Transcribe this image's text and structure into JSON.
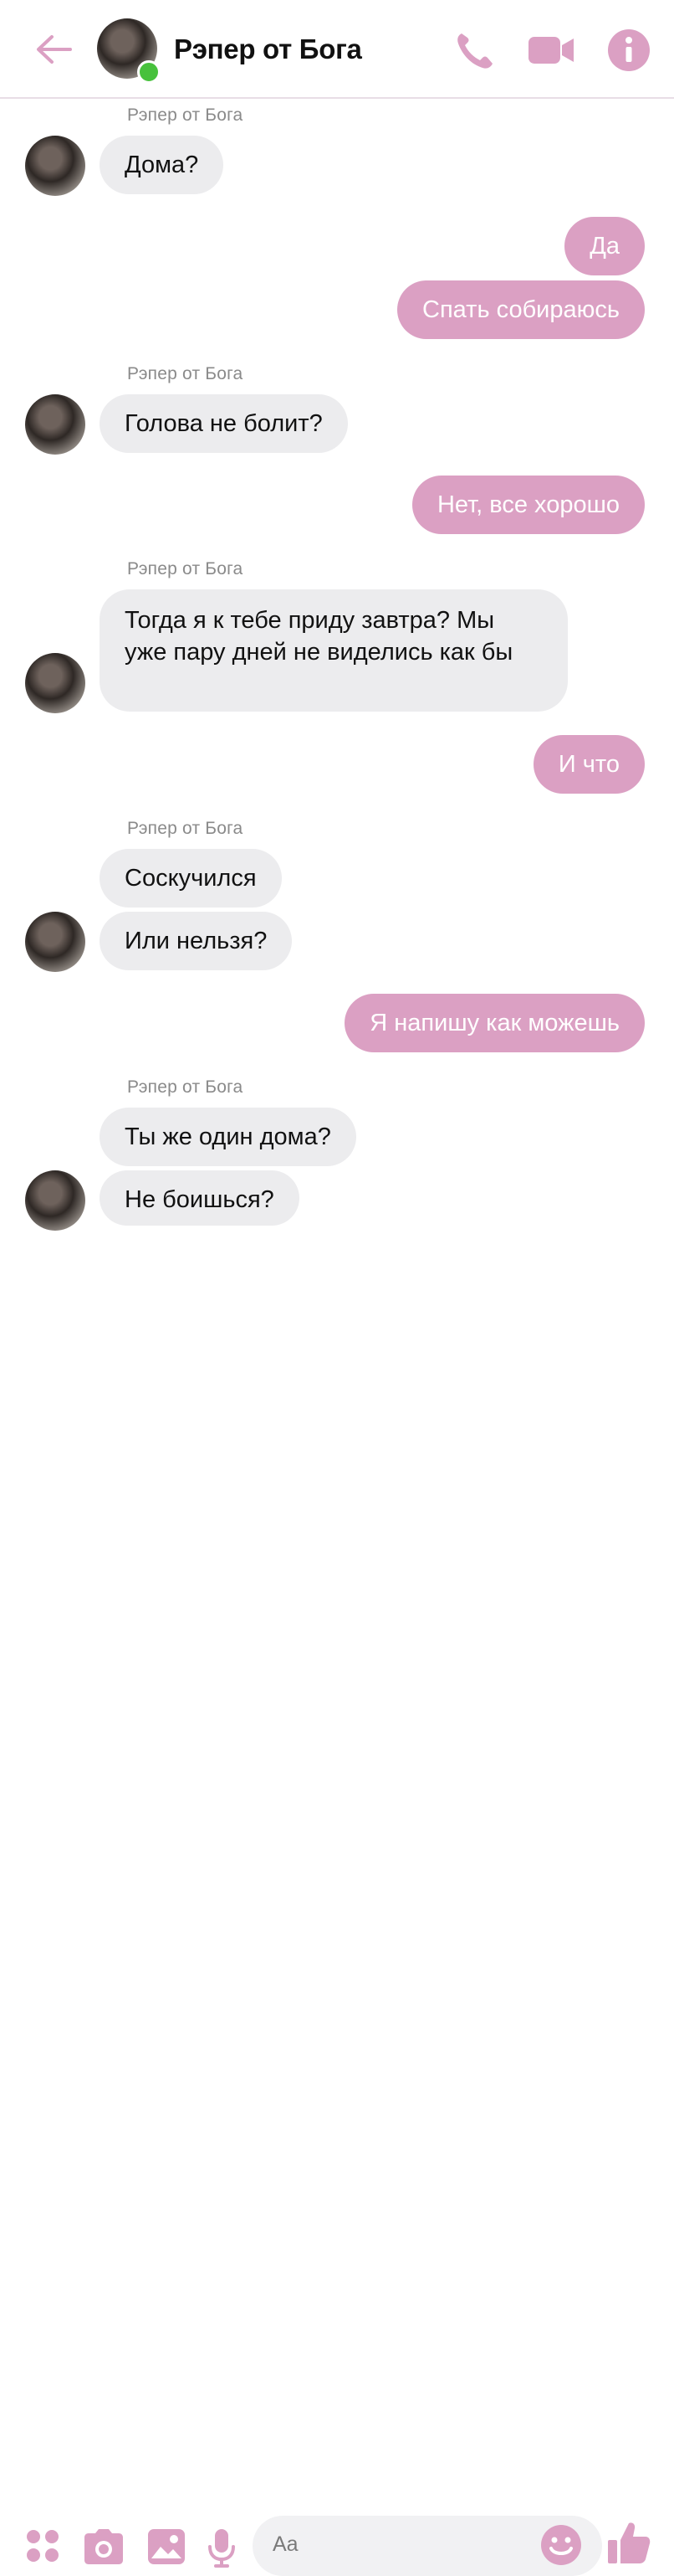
{
  "header": {
    "title": "Рэпер от Бога"
  },
  "accent_color": "#dba0c3",
  "incoming_bubble_color": "#ececee",
  "icons": {
    "back": "arrow-left-icon",
    "call": "phone-icon",
    "video": "video-camera-icon",
    "info": "info-icon",
    "apps": "four-dots-icon",
    "camera": "camera-icon",
    "gallery": "image-icon",
    "mic": "microphone-icon",
    "emoji": "smiley-icon",
    "like": "thumbs-up-icon"
  },
  "messages": [
    {
      "sender": "Рэпер от Бога",
      "text": "Дома?"
    },
    {
      "text": "Да"
    },
    {
      "text": "Спать собираюсь"
    },
    {
      "sender": "Рэпер от Бога",
      "text": "Голова не болит?"
    },
    {
      "text": "Нет, все хорошо"
    },
    {
      "sender": "Рэпер от Бога",
      "text": "Тогда я к тебе приду завтра? Мы уже пару дней не виделись как бы"
    },
    {
      "text": "И что"
    },
    {
      "sender": "Рэпер от Бога",
      "text": "Соскучился"
    },
    {
      "text": "Или нельзя?"
    },
    {
      "text": "Я напишу как можешь"
    },
    {
      "sender": "Рэпер от Бога",
      "text": "Ты же один дома?"
    },
    {
      "text": "Не боишься?"
    }
  ],
  "composer": {
    "placeholder": "Aa"
  }
}
